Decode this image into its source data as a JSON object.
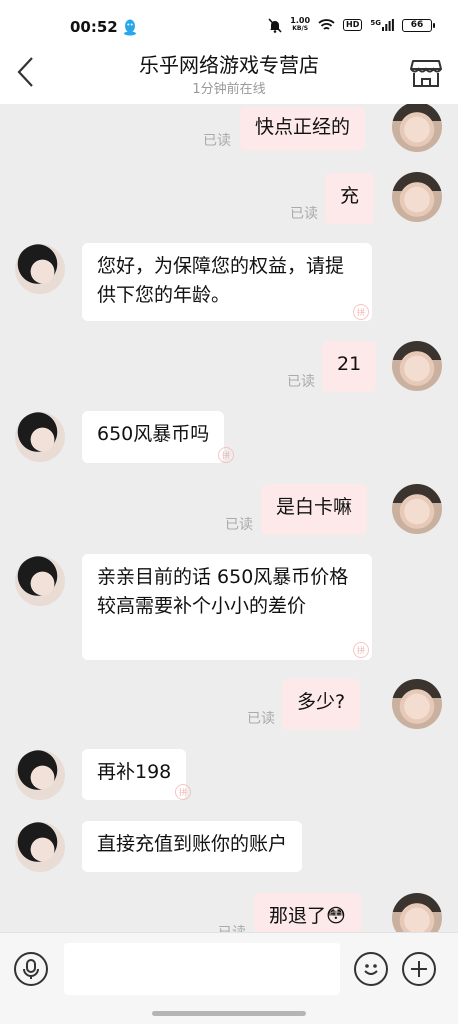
{
  "status_bar": {
    "time": "00:52",
    "net_speed_value": "1.00",
    "net_speed_unit": "KB/S",
    "hd_badge": "HD",
    "network": "5G",
    "battery": "66"
  },
  "header": {
    "title": "乐乎网络游戏专营店",
    "subtitle": "1分钟前在线"
  },
  "messages": [
    {
      "from": "me",
      "text": "快点正经的",
      "read": "已读"
    },
    {
      "from": "me",
      "text": "充",
      "read": "已读"
    },
    {
      "from": "shop",
      "text": "您好，为保障您的权益，请提供下您的年龄。"
    },
    {
      "from": "me",
      "text": "21",
      "read": "已读"
    },
    {
      "from": "shop",
      "text": "650风暴币吗"
    },
    {
      "from": "me",
      "text": "是白卡嘛",
      "read": "已读"
    },
    {
      "from": "shop",
      "text": "亲亲目前的话  650风暴币价格较高需要补个小小的差价"
    },
    {
      "from": "me",
      "text": "多少?",
      "read": "已读"
    },
    {
      "from": "shop",
      "text": "再补198"
    },
    {
      "from": "shop",
      "text": "直接充值到账你的账户"
    },
    {
      "from": "me",
      "text": "那退了😳",
      "read": "已读"
    }
  ],
  "stamp_glyph": "拼",
  "input": {
    "placeholder": ""
  },
  "icons": {
    "back": "chevron-left-icon",
    "store": "store-icon",
    "mic": "microphone-icon",
    "emoji": "smiley-icon",
    "plus": "plus-icon"
  }
}
